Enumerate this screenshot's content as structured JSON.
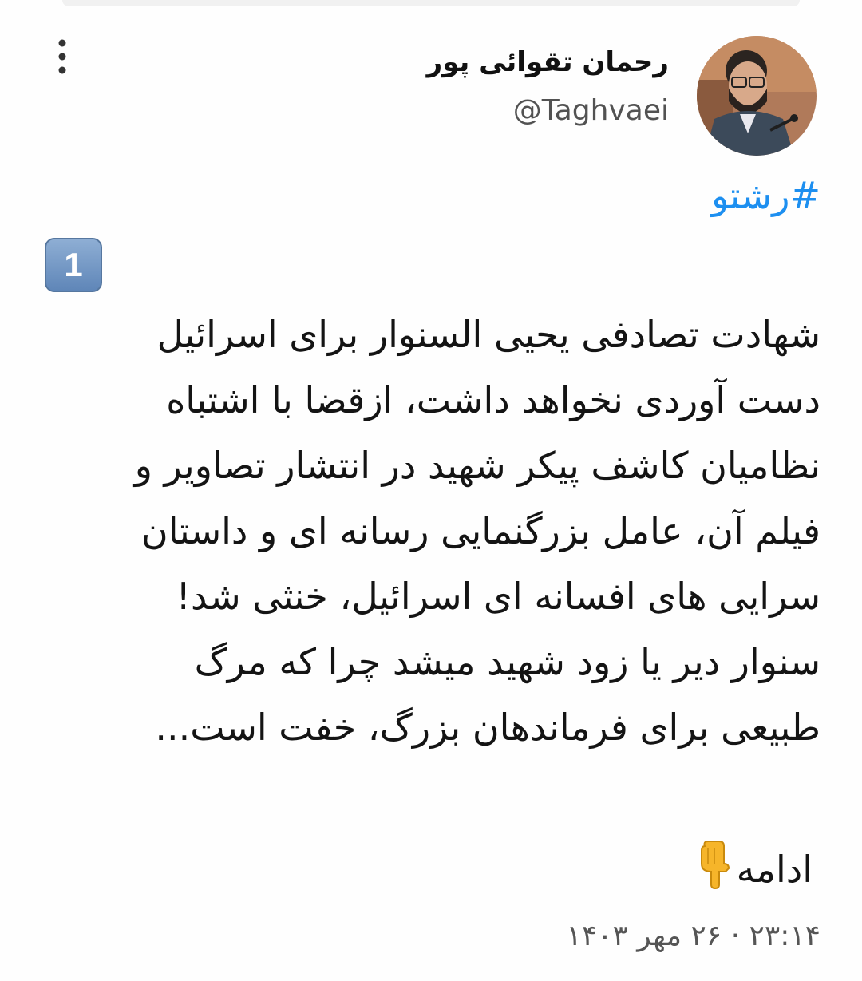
{
  "tweet": {
    "author": {
      "display_name": "رحمان تقوائی پور",
      "handle": "@Taghvaei",
      "avatar_icon": "profile-photo-icon"
    },
    "more_icon": "vertical-ellipsis-icon",
    "hashtag": "#رشتو",
    "thread_number": "1",
    "body_lines": [
      "شهادت تصادفی یحیی السنوار برای اسرائیل",
      "دست آوردی نخواهد داشت، ازقضا با اشتباه",
      "نظامیان کاشف پیکر شهید در انتشار تصاویر و",
      "فیلم آن، عامل بزرگنمایی رسانه ای و داستان",
      "سرایی های افسانه ای اسرائیل، خنثی شد!",
      "سنوار دیر یا زود شهید میشد چرا که مرگ",
      "طبیعی برای فرماندهان بزرگ، خفت است..."
    ],
    "continue_label": "ادامه",
    "continue_icon": "pointing-down-hand-icon",
    "timestamp": "۲۳:۱۴ · ۲۶ مهر ۱۴۰۳",
    "colors": {
      "hashtag": "#1d8ff0",
      "text": "#141414",
      "muted": "#525252",
      "badge": "#6f93c2"
    }
  }
}
